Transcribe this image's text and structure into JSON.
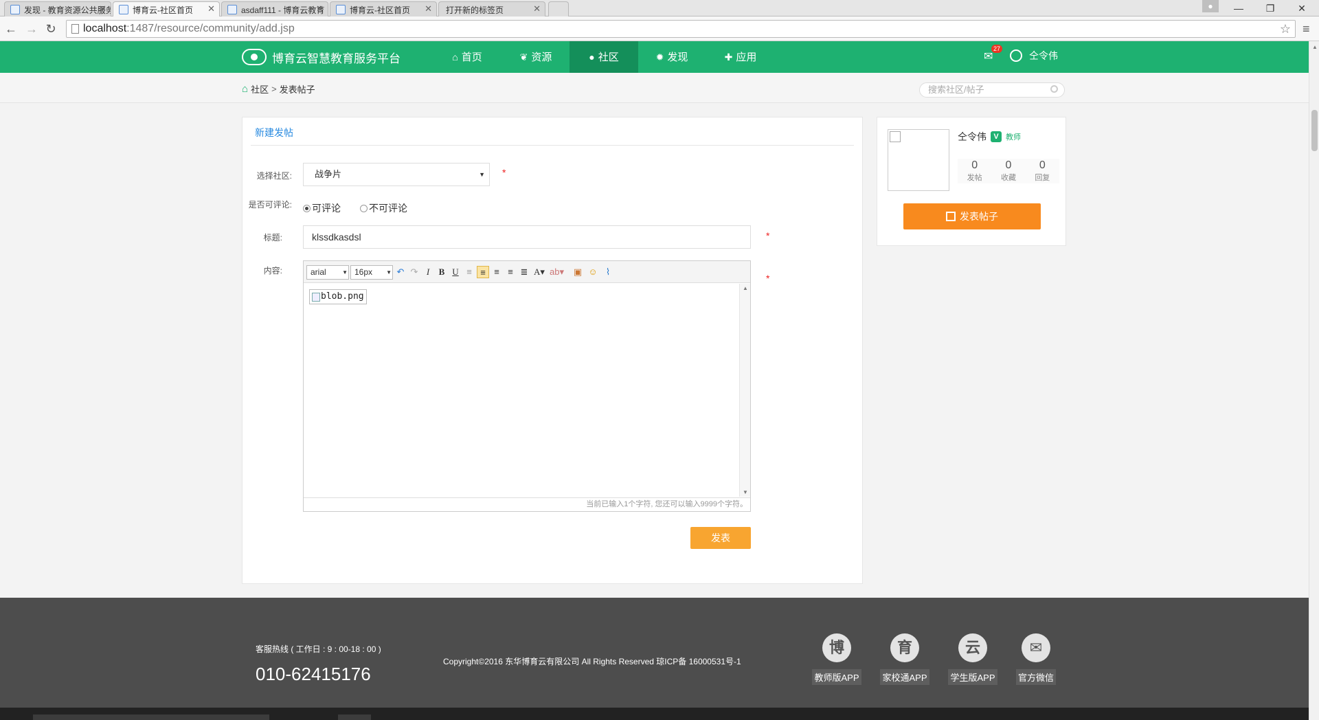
{
  "browser": {
    "tabs": [
      {
        "label": "发现 - 教育资源公共服务平"
      },
      {
        "label": "博育云-社区首页"
      },
      {
        "label": "asdaff111 - 博育云教育"
      },
      {
        "label": "博育云-社区首页"
      },
      {
        "label": "打开新的标签页"
      }
    ],
    "url_host": "localhost",
    "url_path": ":1487/resource/community/add.jsp"
  },
  "header": {
    "logo_text": "博育云智慧教育服务平台",
    "nav": [
      {
        "label": "首页",
        "icon": "home-icon",
        "glyph": "⌂"
      },
      {
        "label": "资源",
        "icon": "leaf-icon",
        "glyph": "❦"
      },
      {
        "label": "社区",
        "icon": "drop-icon",
        "glyph": "●"
      },
      {
        "label": "发现",
        "icon": "sun-icon",
        "glyph": "✹"
      },
      {
        "label": "应用",
        "icon": "plus-square-icon",
        "glyph": "✚"
      }
    ],
    "mail_count": "27",
    "user_name": "仝令伟",
    "accent": "#1eb171"
  },
  "breadcrumb": {
    "root": "社区",
    "sep": ">",
    "current": "发表帖子"
  },
  "search": {
    "placeholder": "搜索社区/帖子"
  },
  "form": {
    "panel_title": "新建发帖",
    "community_label": "选择社区:",
    "community_value": "战争片",
    "comment_label": "是否可评论:",
    "comment_options": [
      "可评论",
      "不可评论"
    ],
    "comment_selected": "可评论",
    "title_label": "标题:",
    "title_value": "klssdkasdsl",
    "content_label": "内容:",
    "required_mark": "*",
    "editor": {
      "font": "arial",
      "size": "16px",
      "image_alt": "blob.png",
      "counter": "当前已输入1个字符, 您还可以输入9999个字符。"
    },
    "submit_label": "发表"
  },
  "profile": {
    "name": "仝令伟",
    "role": "教师",
    "verified_glyph": "V",
    "stats": [
      {
        "value": "0",
        "label": "发帖"
      },
      {
        "value": "0",
        "label": "收藏"
      },
      {
        "value": "0",
        "label": "回复"
      }
    ],
    "post_button": "发表帖子"
  },
  "footer": {
    "hotline_label": "客服热线 ( 工作日 : 9 : 00-18 : 00 )",
    "hotline": "010-62415176",
    "copyright": "Copyright©2016 东华博育云有限公司 All Rights Reserved 琼ICP备 16000531号-1",
    "apps": [
      {
        "glyph": "博",
        "label": "教师版APP"
      },
      {
        "glyph": "育",
        "label": "家校通APP"
      },
      {
        "glyph": "云",
        "label": "学生版APP"
      },
      {
        "glyph": "✉",
        "label": "官方微信"
      }
    ]
  }
}
